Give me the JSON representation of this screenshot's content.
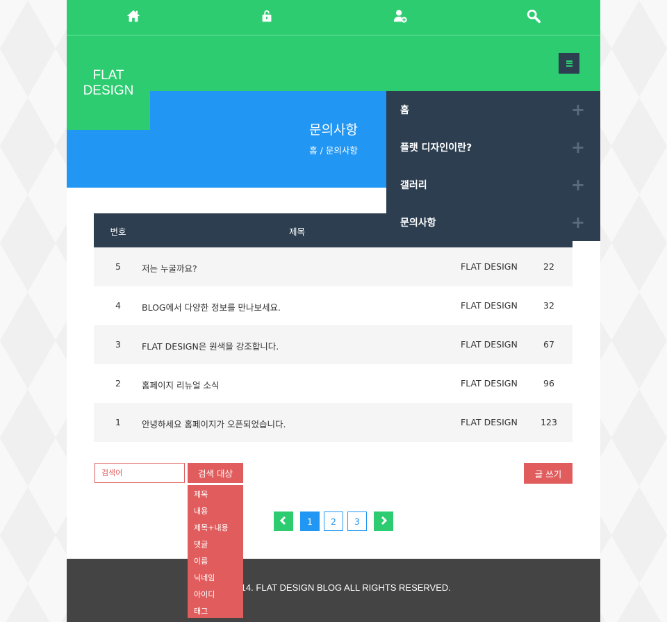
{
  "topbar": {
    "icons": [
      "home-icon",
      "lock-icon",
      "user-add-icon",
      "search-icon"
    ]
  },
  "logo": {
    "line1": "FLAT",
    "line2": "DESIGN"
  },
  "menu_icon": "hamburger-icon",
  "banner": {
    "title": "문의사항",
    "breadcrumb": "홈 / 문의사항"
  },
  "nav": {
    "items": [
      {
        "label": "홈"
      },
      {
        "label": "플랫 디자인이란?"
      },
      {
        "label": "갤러리"
      },
      {
        "label": "문의사항"
      }
    ],
    "expand_glyph": "+"
  },
  "table": {
    "headers": {
      "num": "번호",
      "title": "제목"
    },
    "rows": [
      {
        "num": "5",
        "title": "저는 누굴까요?",
        "author": "FLAT DESIGN",
        "views": "22"
      },
      {
        "num": "4",
        "title": "BLOG에서 다양한 정보를 만나보세요.",
        "author": "FLAT DESIGN",
        "views": "32"
      },
      {
        "num": "3",
        "title": "FLAT DESIGN은 원색을 강조합니다.",
        "author": "FLAT DESIGN",
        "views": "67"
      },
      {
        "num": "2",
        "title": "홈페이지 리뉴얼 소식",
        "author": "FLAT DESIGN",
        "views": "96"
      },
      {
        "num": "1",
        "title": "안녕하세요 홈페이지가 오픈되었습니다.",
        "author": "FLAT DESIGN",
        "views": "123"
      }
    ]
  },
  "search": {
    "placeholder": "검색어",
    "target_label": "검색 대상",
    "options": [
      "제목",
      "내용",
      "제목+내용",
      "댓글",
      "이름",
      "닉네임",
      "아이디",
      "태그"
    ]
  },
  "write_label": "글 쓰기",
  "pagination": {
    "pages": [
      "1",
      "2",
      "3"
    ],
    "current": "1"
  },
  "footer": {
    "copyright": "T© 2014. FLAT DESIGN BLOG ALL RIGHTS RESERVED."
  },
  "colors": {
    "green": "#2ecc71",
    "blue": "#2196f3",
    "navy": "#2c3e50",
    "red": "#e15d5d",
    "footer": "#444444"
  }
}
